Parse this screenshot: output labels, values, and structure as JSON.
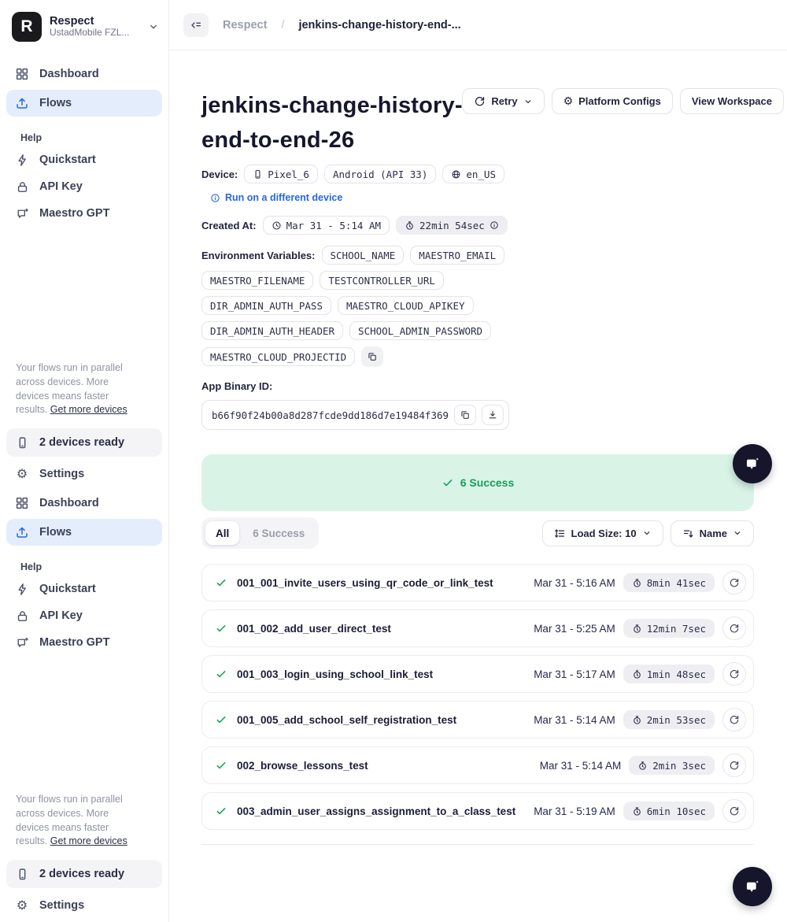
{
  "sidebar": {
    "workspace_name": "Respect",
    "org_name": "UstadMobile FZL...",
    "nav": {
      "dashboard": "Dashboard",
      "flows": "Flows",
      "help": "Help",
      "quickstart": "Quickstart",
      "api_key": "API Key",
      "maestro_gpt": "Maestro GPT",
      "settings": "Settings"
    },
    "promo_text": "Your flows run in parallel across devices. More devices means faster results. ",
    "promo_link": "Get more devices",
    "devices_ready": "2 devices ready"
  },
  "breadcrumb": {
    "workspace": "Respect",
    "separator": "/",
    "current": "jenkins-change-history-end-..."
  },
  "header": {
    "title": "jenkins-change-history-end-to-end-26",
    "retry_label": "Retry",
    "platform_configs_label": "Platform Configs",
    "view_workspace_label": "View Workspace"
  },
  "meta": {
    "device_label": "Device:",
    "device_name": "Pixel_6",
    "device_os": "Android (API 33)",
    "device_locale": "en_US",
    "run_different_device": "Run on a different device",
    "created_label": "Created At:",
    "created_value": "Mar 31 - 5:14 AM",
    "duration_value": "22min 54sec",
    "env_label": "Environment Variables:",
    "env_vars": [
      "SCHOOL_NAME",
      "MAESTRO_EMAIL",
      "MAESTRO_FILENAME",
      "TESTCONTROLLER_URL",
      "DIR_ADMIN_AUTH_PASS",
      "MAESTRO_CLOUD_APIKEY",
      "DIR_ADMIN_AUTH_HEADER",
      "SCHOOL_ADMIN_PASSWORD",
      "MAESTRO_CLOUD_PROJECTID"
    ],
    "app_binary_label": "App Binary ID:",
    "app_binary_id": "b66f90f24b00a8d287fcde9dd186d7e19484f369"
  },
  "results": {
    "banner_text": "6 Success",
    "tab_all": "All",
    "tab_success": "6 Success",
    "load_size_label": "Load Size: 10",
    "sort_label": "Name",
    "rows": [
      {
        "name": "001_001_invite_users_using_qr_code_or_link_test",
        "date": "Mar 31 - 5:16 AM",
        "duration": "8min 41sec"
      },
      {
        "name": "001_002_add_user_direct_test",
        "date": "Mar 31 - 5:25 AM",
        "duration": "12min 7sec"
      },
      {
        "name": "001_003_login_using_school_link_test",
        "date": "Mar 31 - 5:17 AM",
        "duration": "1min 48sec"
      },
      {
        "name": "001_005_add_school_self_registration_test",
        "date": "Mar 31 - 5:14 AM",
        "duration": "2min 53sec"
      },
      {
        "name": "002_browse_lessons_test",
        "date": "Mar 31 - 5:14 AM",
        "duration": "2min 3sec"
      },
      {
        "name": "003_admin_user_assigns_assignment_to_a_class_test",
        "date": "Mar 31 - 5:19 AM",
        "duration": "6min 10sec"
      }
    ]
  },
  "colors": {
    "accent_blue": "#2566e8",
    "success_green": "#16a05a",
    "success_banner_bg": "#d9f4e7",
    "active_nav_bg": "#e4edfc",
    "dark_navy": "#15162b"
  }
}
